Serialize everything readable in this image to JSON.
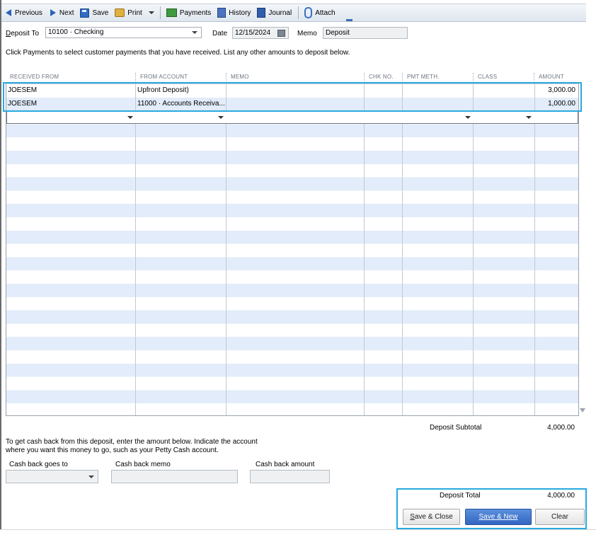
{
  "toolbar": {
    "previous": "Previous",
    "next": "Next",
    "save": "Save",
    "print": "Print",
    "payments": "Payments",
    "history": "History",
    "journal": "Journal",
    "attach": "Attach"
  },
  "header": {
    "deposit_to_label": "Deposit To",
    "deposit_to_value": "10100 · Checking",
    "date_label": "Date",
    "date_value": "12/15/2024",
    "memo_label": "Memo",
    "memo_value": "Deposit"
  },
  "instructions": "Click Payments to select customer payments that you have received. List any other amounts to deposit below.",
  "table": {
    "columns": [
      "RECEIVED FROM",
      "FROM ACCOUNT",
      "MEMO",
      "CHK NO.",
      "PMT METH.",
      "CLASS",
      "AMOUNT"
    ],
    "rows": [
      {
        "received_from": "JOESEM",
        "from_account": "Upfront Deposit)",
        "memo": "",
        "chk_no": "",
        "pmt_meth": "",
        "class": "",
        "amount": "3,000.00"
      },
      {
        "received_from": "JOESEM",
        "from_account": "11000 · Accounts Receiva...",
        "memo": "",
        "chk_no": "",
        "pmt_meth": "",
        "class": "",
        "amount": "1,000.00"
      }
    ]
  },
  "subtotal": {
    "label": "Deposit Subtotal",
    "value": "4,000.00"
  },
  "cashback": {
    "instructions_line1": "To get cash back from this deposit, enter the amount below.  Indicate the account",
    "instructions_line2": "where you want this money to go, such as your Petty Cash account.",
    "goes_to_label": "Cash back goes to",
    "memo_label": "Cash back memo",
    "amount_label": "Cash back amount"
  },
  "total": {
    "label": "Deposit Total",
    "value": "4,000.00"
  },
  "buttons": {
    "save_close_u": "S",
    "save_close_rest": "ave & Close",
    "save_new_u": "S",
    "save_new_rest": "ave & New",
    "clear": "Clear"
  }
}
